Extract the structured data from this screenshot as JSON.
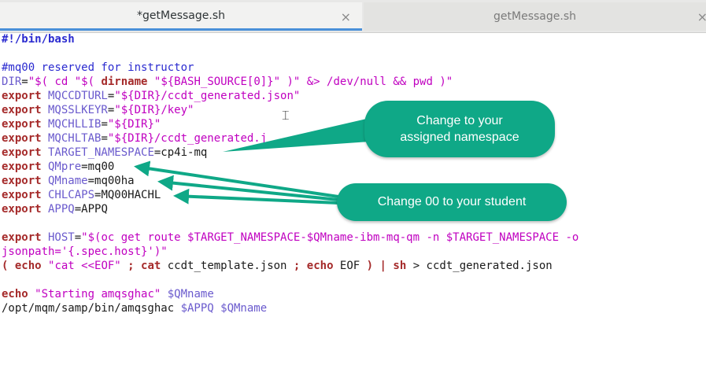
{
  "tabs": [
    {
      "label": "*getMessage.sh",
      "close": "×",
      "active": true
    },
    {
      "label": "getMessage.sh",
      "close": "×",
      "active": false
    }
  ],
  "code": [
    [
      {
        "t": "#!/bin/bash",
        "c": "sheb"
      }
    ],
    [],
    [
      {
        "t": "#mq00 reserved for instructor",
        "c": "cmt"
      }
    ],
    [
      {
        "t": "DIR",
        "c": "var"
      },
      {
        "t": "=",
        "c": "plain"
      },
      {
        "t": "\"$( cd \"$( ",
        "c": "str"
      },
      {
        "t": "dirname",
        "c": "kw"
      },
      {
        "t": " \"${BASH_SOURCE[0]}\" )\" &> /dev/null && pwd )\"",
        "c": "str"
      }
    ],
    [
      {
        "t": "export",
        "c": "kw"
      },
      {
        "t": " MQCCDTURL",
        "c": "var"
      },
      {
        "t": "=",
        "c": "plain"
      },
      {
        "t": "\"${DIR}/ccdt_generated.json\"",
        "c": "str"
      }
    ],
    [
      {
        "t": "export",
        "c": "kw"
      },
      {
        "t": " MQSSLKEYR",
        "c": "var"
      },
      {
        "t": "=",
        "c": "plain"
      },
      {
        "t": "\"${DIR}/key\"",
        "c": "str"
      }
    ],
    [
      {
        "t": "export",
        "c": "kw"
      },
      {
        "t": " MQCHLLIB",
        "c": "var"
      },
      {
        "t": "=",
        "c": "plain"
      },
      {
        "t": "\"${DIR}\"",
        "c": "str"
      }
    ],
    [
      {
        "t": "export",
        "c": "kw"
      },
      {
        "t": " MQCHLTAB",
        "c": "var"
      },
      {
        "t": "=",
        "c": "plain"
      },
      {
        "t": "\"${DIR}/ccdt_generated.j",
        "c": "str"
      }
    ],
    [
      {
        "t": "export",
        "c": "kw"
      },
      {
        "t": " TARGET_NAMESPACE",
        "c": "var"
      },
      {
        "t": "=cp4i-mq",
        "c": "plain"
      }
    ],
    [
      {
        "t": "export",
        "c": "kw"
      },
      {
        "t": " QMpre",
        "c": "var"
      },
      {
        "t": "=mq00",
        "c": "plain"
      }
    ],
    [
      {
        "t": "export",
        "c": "kw"
      },
      {
        "t": " QMname",
        "c": "var"
      },
      {
        "t": "=mq00ha",
        "c": "plain"
      }
    ],
    [
      {
        "t": "export",
        "c": "kw"
      },
      {
        "t": " CHLCAPS",
        "c": "var"
      },
      {
        "t": "=MQ00HACHL",
        "c": "plain"
      }
    ],
    [
      {
        "t": "export",
        "c": "kw"
      },
      {
        "t": " APPQ",
        "c": "var"
      },
      {
        "t": "=APPQ",
        "c": "plain"
      }
    ],
    [],
    [
      {
        "t": "export",
        "c": "kw"
      },
      {
        "t": " HOST",
        "c": "var"
      },
      {
        "t": "=",
        "c": "plain"
      },
      {
        "t": "\"$(oc get route $TARGET_NAMESPACE-$QMname-ibm-mq-qm -n $TARGET_NAMESPACE -o",
        "c": "str"
      }
    ],
    [
      {
        "t": "jsonpath='{.spec.host}')\"",
        "c": "str"
      }
    ],
    [
      {
        "t": "( ",
        "c": "kw"
      },
      {
        "t": "echo",
        "c": "kw"
      },
      {
        "t": " ",
        "c": "plain"
      },
      {
        "t": "\"cat <<EOF\"",
        "c": "str"
      },
      {
        "t": " ; ",
        "c": "kw"
      },
      {
        "t": "cat",
        "c": "kw"
      },
      {
        "t": " ccdt_template.json ",
        "c": "plain"
      },
      {
        "t": ";",
        "c": "kw"
      },
      {
        "t": " ",
        "c": "plain"
      },
      {
        "t": "echo",
        "c": "kw"
      },
      {
        "t": " EOF ",
        "c": "plain"
      },
      {
        "t": ")",
        "c": "kw"
      },
      {
        "t": " ",
        "c": "plain"
      },
      {
        "t": "|",
        "c": "kw"
      },
      {
        "t": " ",
        "c": "plain"
      },
      {
        "t": "sh",
        "c": "kw"
      },
      {
        "t": " > ccdt_generated.json",
        "c": "plain"
      }
    ],
    [],
    [
      {
        "t": "echo",
        "c": "kw"
      },
      {
        "t": " ",
        "c": "plain"
      },
      {
        "t": "\"Starting amqsghac\"",
        "c": "str"
      },
      {
        "t": " $QMname",
        "c": "var"
      }
    ],
    [
      {
        "t": "/opt/mqm/samp/bin/amqsghac ",
        "c": "plain"
      },
      {
        "t": "$APPQ $QMname",
        "c": "var"
      }
    ]
  ],
  "callouts": {
    "namespace": {
      "line1": "Change to your",
      "line2": "assigned namespace"
    },
    "student": {
      "text": "Change 00 to your student"
    }
  },
  "colors": {
    "callout": "#0fa887",
    "tab_indicator": "#4a90d9",
    "keyword": "#a52a2a",
    "string": "#c000c0",
    "variable": "#6a5acd"
  },
  "icons": {
    "cursor": "text-cursor-icon",
    "close": "close-icon"
  }
}
